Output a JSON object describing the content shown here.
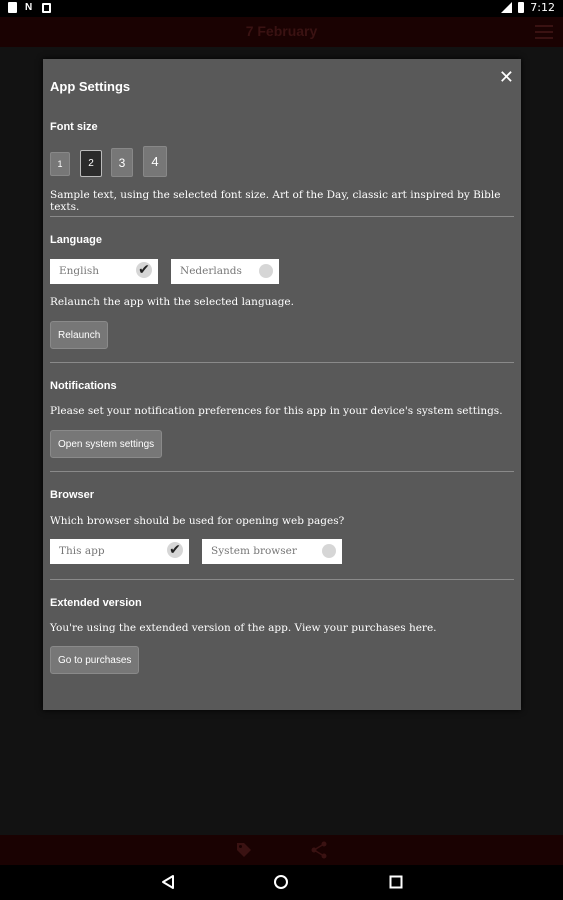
{
  "status_bar": {
    "time": "7:12"
  },
  "app_bar": {
    "title": "7 February"
  },
  "dialog": {
    "title": "App Settings",
    "font_size": {
      "heading": "Font size",
      "options": [
        "1",
        "2",
        "3",
        "4"
      ],
      "selected": "2",
      "sample": "Sample text, using the selected font size. Art of the Day, classic art inspired by Bible texts."
    },
    "language": {
      "heading": "Language",
      "options": [
        {
          "label": "English",
          "selected": true
        },
        {
          "label": "Nederlands",
          "selected": false
        }
      ],
      "info": "Relaunch the app with the selected language.",
      "button": "Relaunch"
    },
    "notifications": {
      "heading": "Notifications",
      "info": "Please set your notification preferences for this app in your device's system settings.",
      "button": "Open system settings"
    },
    "browser": {
      "heading": "Browser",
      "question": "Which browser should be used for opening web pages?",
      "options": [
        {
          "label": "This app",
          "selected": true
        },
        {
          "label": "System browser",
          "selected": false
        }
      ]
    },
    "extended": {
      "heading": "Extended version",
      "info": "You're using the extended version of the app. View your purchases here.",
      "button": "Go to purchases"
    }
  },
  "icons": {
    "close": "close-icon",
    "tag": "tag-icon",
    "share": "share-icon",
    "back": "back-icon",
    "home": "home-icon",
    "recents": "recents-icon",
    "menu": "menu-icon"
  },
  "colors": {
    "background": "#121212",
    "dialog": "#595959",
    "appbar": "#1a0202",
    "button": "#777777"
  }
}
